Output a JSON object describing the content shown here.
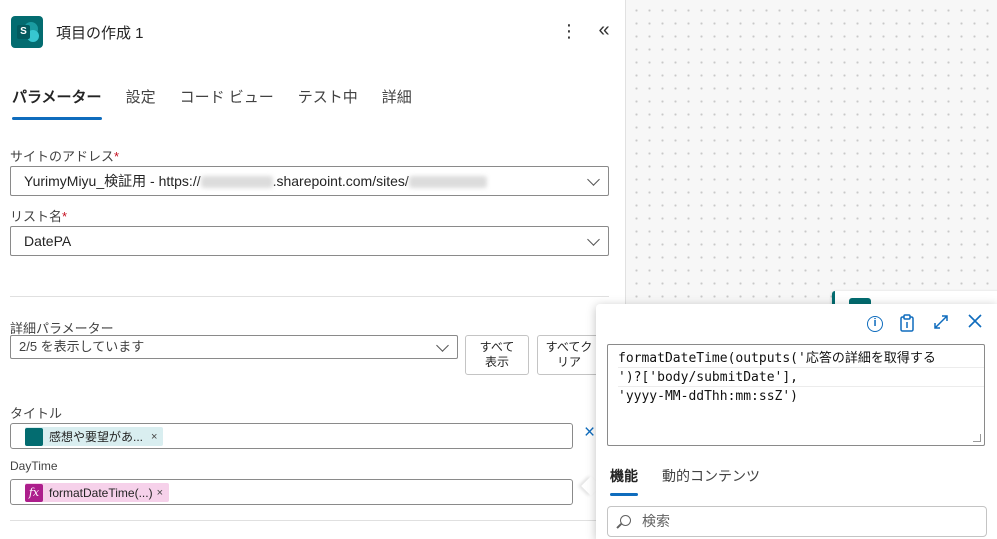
{
  "header": {
    "title": "項目の作成 1",
    "logo_letter": "S",
    "more_icon": "more-vertical-icon",
    "collapse_icon": "double-chevron-left-icon"
  },
  "tabs": [
    {
      "label": "パラメーター",
      "active": true
    },
    {
      "label": "設定",
      "active": false
    },
    {
      "label": "コード ビュー",
      "active": false
    },
    {
      "label": "テスト中",
      "active": false
    },
    {
      "label": "詳細",
      "active": false
    }
  ],
  "site_address": {
    "label": "サイトのアドレス",
    "required": "*",
    "value_prefix": "YurimyMiyu_検証用 - https://",
    "value_middle": ".sharepoint.com/sites/"
  },
  "list_name": {
    "label": "リスト名",
    "required": "*",
    "value": "DatePA"
  },
  "advanced": {
    "label": "詳細パラメーター",
    "value": "2/5 を表示しています",
    "show_all_line1": "すべて",
    "show_all_line2": "表示",
    "clear_all_line1": "すべてク",
    "clear_all_line2": "リア"
  },
  "title_field": {
    "label": "タイトル",
    "token_text": "感想や要望があ...",
    "token_remove": "×",
    "clear_icon": "×"
  },
  "daytime_field": {
    "label": "DayTime",
    "token_text": "formatDateTime(...)",
    "token_icon": "fx",
    "token_remove": "×"
  },
  "popup": {
    "code_lines": [
      "formatDateTime(outputs('応答の詳細を取得する",
      "')?['body/submitDate'],",
      "'yyyy-MM-ddThh:mm:ssZ')"
    ],
    "tabs": [
      {
        "label": "機能",
        "active": true
      },
      {
        "label": "動的コンテンツ",
        "active": false
      }
    ],
    "search_placeholder": "検索"
  },
  "colors": {
    "accent": "#0f6cbd",
    "sharepoint": "#036c70",
    "expression_token": "#f6d1ea",
    "dynamic_token": "#d9eef0"
  }
}
